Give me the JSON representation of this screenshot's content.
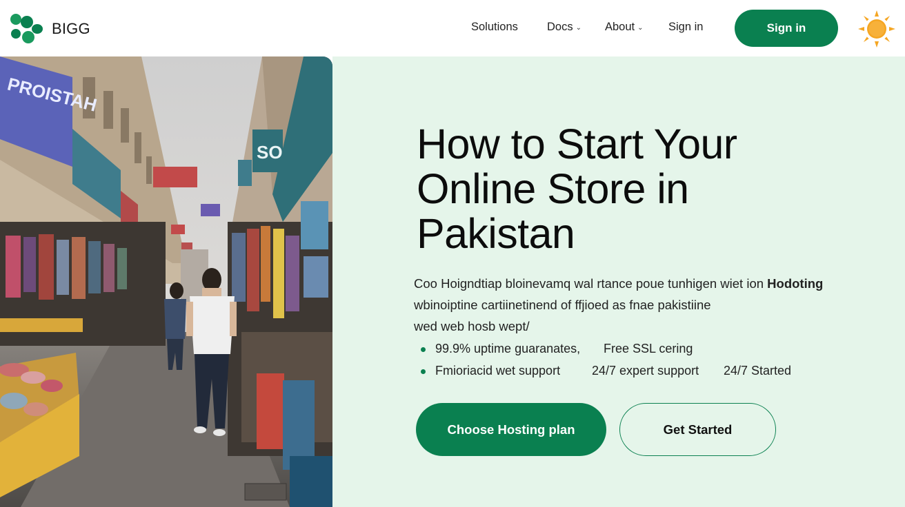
{
  "header": {
    "brand": "BIGG",
    "nav": [
      {
        "label": "Solutions",
        "has_dropdown": false
      },
      {
        "label": "Docs",
        "has_dropdown": true
      },
      {
        "label": "About",
        "has_dropdown": true
      },
      {
        "label": "Sign in",
        "has_dropdown": false
      }
    ],
    "cta_label": "Sign in",
    "theme_icon": "sun-icon"
  },
  "hero": {
    "image_icon": "market-street-photo",
    "sign_texts": [
      "PROISTAH",
      "SO"
    ],
    "headline": "How to Start Your Online Store in Pakistan",
    "paragraph": {
      "line1": "Coo Hoigndtiap bloinevamq wal rtance poue tunhigen wiet ion",
      "line1_strong": "Hodoting",
      "line2": "wbinoiptine cartiinetinend of ffjioed as fnae pakistiine",
      "line3": "wed web hosb wept/"
    },
    "bullets": [
      {
        "left": "99.9% uptime guaranates,",
        "right": "Free SSL cering"
      },
      {
        "left": "Fmioriacid wet support",
        "middle": "24/7 expert support",
        "right": "24/7 Started"
      }
    ],
    "primary_button": "Choose Hosting plan",
    "secondary_button": "Get Started"
  },
  "colors": {
    "accent": "#0a8050",
    "panel_bg": "#e5f5ea",
    "sun": "#f5a623"
  }
}
